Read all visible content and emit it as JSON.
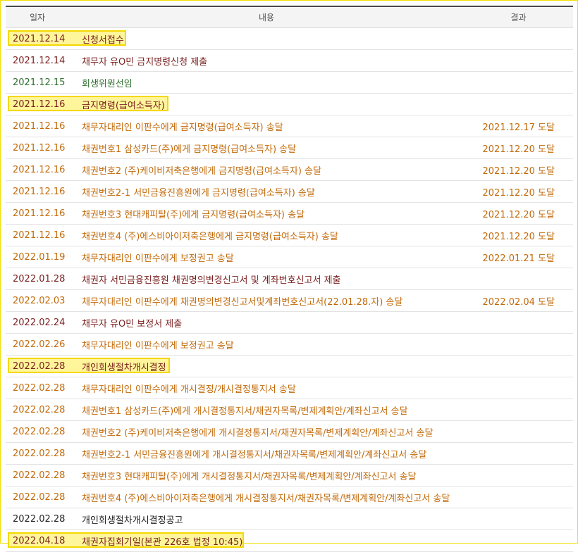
{
  "headers": {
    "date": "일자",
    "content": "내용",
    "result": "결과"
  },
  "rows": [
    {
      "date": "2021.12.14",
      "desc": "신청서접수",
      "result": "",
      "color": "maroon",
      "highlight": true
    },
    {
      "date": "2021.12.14",
      "desc": "채무자 유O민 금지명령신청 제출",
      "result": "",
      "color": "maroon",
      "highlight": false
    },
    {
      "date": "2021.12.15",
      "desc": "회생위원선임",
      "result": "",
      "color": "green",
      "highlight": false
    },
    {
      "date": "2021.12.16",
      "desc": "금지명령(급여소득자)",
      "result": "",
      "color": "maroon",
      "highlight": true
    },
    {
      "date": "2021.12.16",
      "desc": "채무자대리인 이판수에게 금지명령(급여소득자) 송달",
      "result": "2021.12.17 도달",
      "color": "orange",
      "highlight": false
    },
    {
      "date": "2021.12.16",
      "desc": "채권번호1 삼성카드(주)에게 금지명령(급여소득자) 송달",
      "result": "2021.12.20 도달",
      "color": "orange",
      "highlight": false
    },
    {
      "date": "2021.12.16",
      "desc": "채권번호2 (주)케이비저축은행에게 금지명령(급여소득자) 송달",
      "result": "2021.12.20 도달",
      "color": "orange",
      "highlight": false
    },
    {
      "date": "2021.12.16",
      "desc": "채권번호2-1 서민금융진흥원에게 금지명령(급여소득자) 송달",
      "result": "2021.12.20 도달",
      "color": "orange",
      "highlight": false
    },
    {
      "date": "2021.12.16",
      "desc": "채권번호3 현대캐피탈(주)에게 금지명령(급여소득자) 송달",
      "result": "2021.12.20 도달",
      "color": "orange",
      "highlight": false
    },
    {
      "date": "2021.12.16",
      "desc": "채권번호4 (주)에스비아이저축은행에게 금지명령(급여소득자) 송달",
      "result": "2021.12.20 도달",
      "color": "orange",
      "highlight": false
    },
    {
      "date": "2022.01.19",
      "desc": "채무자대리인 이판수에게 보정권고 송달",
      "result": "2022.01.21 도달",
      "color": "orange",
      "highlight": false
    },
    {
      "date": "2022.01.28",
      "desc": "채권자 서민금융진흥원 채권명의변경신고서 및 계좌번호신고서 제출",
      "result": "",
      "color": "maroon",
      "highlight": false
    },
    {
      "date": "2022.02.03",
      "desc": "채무자대리인 이판수에게 채권명의변경신고서및계좌번호신고서(22.01.28.자) 송달",
      "result": "2022.02.04 도달",
      "color": "orange",
      "highlight": false
    },
    {
      "date": "2022.02.24",
      "desc": "채무자 유O민 보정서 제출",
      "result": "",
      "color": "maroon",
      "highlight": false
    },
    {
      "date": "2022.02.26",
      "desc": "채무자대리인 이판수에게 보정권고 송달",
      "result": "",
      "color": "orange",
      "highlight": false
    },
    {
      "date": "2022.02.28",
      "desc": "개인회생절차개시결정",
      "result": "",
      "color": "maroon",
      "highlight": true
    },
    {
      "date": "2022.02.28",
      "desc": "채무자대리인 이판수에게 개시결정/개시결정통지서 송달",
      "result": "",
      "color": "orange",
      "highlight": false
    },
    {
      "date": "2022.02.28",
      "desc": "채권번호1 삼성카드(주)에게 개시결정통지서/채권자목록/변제계획안/계좌신고서 송달",
      "result": "",
      "color": "orange",
      "highlight": false
    },
    {
      "date": "2022.02.28",
      "desc": "채권번호2 (주)케이비저축은행에게 개시결정통지서/채권자목록/변제계획안/계좌신고서 송달",
      "result": "",
      "color": "orange",
      "highlight": false
    },
    {
      "date": "2022.02.28",
      "desc": "채권번호2-1 서민금융진흥원에게 개시결정통지서/채권자목록/변제계획안/계좌신고서 송달",
      "result": "",
      "color": "orange",
      "highlight": false
    },
    {
      "date": "2022.02.28",
      "desc": "채권번호3 현대캐피탈(주)에게 개시결정통지서/채권자목록/변제계획안/계좌신고서 송달",
      "result": "",
      "color": "orange",
      "highlight": false
    },
    {
      "date": "2022.02.28",
      "desc": "채권번호4 (주)에스비아이저축은행에게 개시결정통지서/채권자목록/변제계획안/계좌신고서 송달",
      "result": "",
      "color": "orange",
      "highlight": false
    },
    {
      "date": "2022.02.28",
      "desc": "개인회생절차개시결정공고",
      "result": "",
      "color": "black",
      "highlight": false
    },
    {
      "date": "2022.04.18",
      "desc": "채권자집회기일(본관 226호 법정 10:45)",
      "result": "",
      "color": "maroon",
      "highlight": true
    }
  ],
  "colors": {
    "maroon": "#7a1f1f",
    "green": "#2e6e2e",
    "orange": "#c26a0a",
    "black": "#222222",
    "highlight": "#fff59a",
    "highlight_border": "#f4d800"
  }
}
